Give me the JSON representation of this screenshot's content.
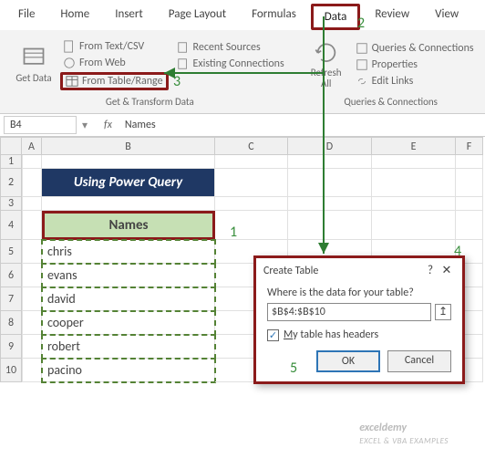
{
  "tabs": {
    "items": [
      "File",
      "Home",
      "Insert",
      "Page Layout",
      "Formulas",
      "Data",
      "Review",
      "View"
    ],
    "active": "Data",
    "more": "⋯"
  },
  "ribbon": {
    "group1": {
      "title": "Get & Transform Data",
      "getdata": "Get Data",
      "fromtext": "From Text/CSV",
      "fromweb": "From Web",
      "fromtable": "From Table/Range",
      "recent": "Recent Sources",
      "existing": "Existing Connections"
    },
    "group2": {
      "title": "Queries & Connections",
      "refresh": "Refresh All",
      "queries": "Queries & Connections",
      "props": "Properties",
      "edit": "Edit Links"
    }
  },
  "namebox": "B4",
  "formula": "Names",
  "cols": [
    "A",
    "B",
    "C",
    "D",
    "E",
    "F"
  ],
  "rows": [
    "1",
    "2",
    "3",
    "4",
    "5",
    "6",
    "7",
    "8",
    "9",
    "10"
  ],
  "banner": "Using Power Query",
  "header": "Names",
  "data": [
    "chris",
    "evans",
    "david",
    "cooper",
    "robert",
    "pacino"
  ],
  "dialog": {
    "title": "Create Table",
    "help": "?",
    "close": "✕",
    "q": "Where is the data for your table?",
    "range": "$B$4:$B$10",
    "pick": "↥",
    "chk": "✓",
    "chklabel_pre": "M",
    "chklabel_rest": "y table has headers",
    "ok": "OK",
    "cancel": "Cancel"
  },
  "callouts": {
    "c1": "1",
    "c2": "2",
    "c3": "3",
    "c4": "4",
    "c5": "5"
  },
  "wm1": "exceldemy",
  "wm2": "EXCEL & VBA EXAMPLES"
}
